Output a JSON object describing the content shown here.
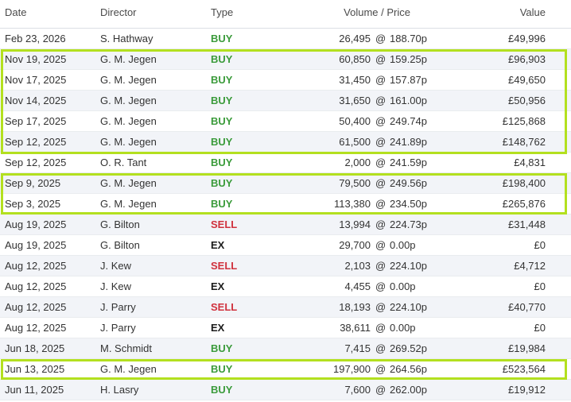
{
  "header": {
    "date": "Date",
    "director": "Director",
    "type": "Type",
    "volume_price": "Volume / Price",
    "value": "Value"
  },
  "separator": "@",
  "rows": [
    {
      "date": "Feb 23, 2026",
      "director": "S. Hathway",
      "type": "BUY",
      "volume": "26,495",
      "price": "188.70p",
      "value": "£49,996"
    },
    {
      "date": "Nov 19, 2025",
      "director": "G. M. Jegen",
      "type": "BUY",
      "volume": "60,850",
      "price": "159.25p",
      "value": "£96,903"
    },
    {
      "date": "Nov 17, 2025",
      "director": "G. M. Jegen",
      "type": "BUY",
      "volume": "31,450",
      "price": "157.87p",
      "value": "£49,650"
    },
    {
      "date": "Nov 14, 2025",
      "director": "G. M. Jegen",
      "type": "BUY",
      "volume": "31,650",
      "price": "161.00p",
      "value": "£50,956"
    },
    {
      "date": "Sep 17, 2025",
      "director": "G. M. Jegen",
      "type": "BUY",
      "volume": "50,400",
      "price": "249.74p",
      "value": "£125,868"
    },
    {
      "date": "Sep 12, 2025",
      "director": "G. M. Jegen",
      "type": "BUY",
      "volume": "61,500",
      "price": "241.89p",
      "value": "£148,762"
    },
    {
      "date": "Sep 12, 2025",
      "director": "O. R. Tant",
      "type": "BUY",
      "volume": "2,000",
      "price": "241.59p",
      "value": "£4,831"
    },
    {
      "date": "Sep 9, 2025",
      "director": "G. M. Jegen",
      "type": "BUY",
      "volume": "79,500",
      "price": "249.56p",
      "value": "£198,400"
    },
    {
      "date": "Sep 3, 2025",
      "director": "G. M. Jegen",
      "type": "BUY",
      "volume": "113,380",
      "price": "234.50p",
      "value": "£265,876"
    },
    {
      "date": "Aug 19, 2025",
      "director": "G. Bilton",
      "type": "SELL",
      "volume": "13,994",
      "price": "224.73p",
      "value": "£31,448"
    },
    {
      "date": "Aug 19, 2025",
      "director": "G. Bilton",
      "type": "EX",
      "volume": "29,700",
      "price": "0.00p",
      "value": "£0"
    },
    {
      "date": "Aug 12, 2025",
      "director": "J. Kew",
      "type": "SELL",
      "volume": "2,103",
      "price": "224.10p",
      "value": "£4,712"
    },
    {
      "date": "Aug 12, 2025",
      "director": "J. Kew",
      "type": "EX",
      "volume": "4,455",
      "price": "0.00p",
      "value": "£0"
    },
    {
      "date": "Aug 12, 2025",
      "director": "J. Parry",
      "type": "SELL",
      "volume": "18,193",
      "price": "224.10p",
      "value": "£40,770"
    },
    {
      "date": "Aug 12, 2025",
      "director": "J. Parry",
      "type": "EX",
      "volume": "38,611",
      "price": "0.00p",
      "value": "£0"
    },
    {
      "date": "Jun 18, 2025",
      "director": "M. Schmidt",
      "type": "BUY",
      "volume": "7,415",
      "price": "269.52p",
      "value": "£19,984"
    },
    {
      "date": "Jun 13, 2025",
      "director": "G. M. Jegen",
      "type": "BUY",
      "volume": "197,900",
      "price": "264.56p",
      "value": "£523,564"
    },
    {
      "date": "Jun 11, 2025",
      "director": "H. Lasry",
      "type": "BUY",
      "volume": "7,600",
      "price": "262.00p",
      "value": "£19,912"
    }
  ],
  "colors": {
    "buy": "#3b9b3b",
    "sell": "#d0313d",
    "ex": "#1b1b1b",
    "highlight": "#b3e01f",
    "alt_row": "#f2f4f8"
  }
}
